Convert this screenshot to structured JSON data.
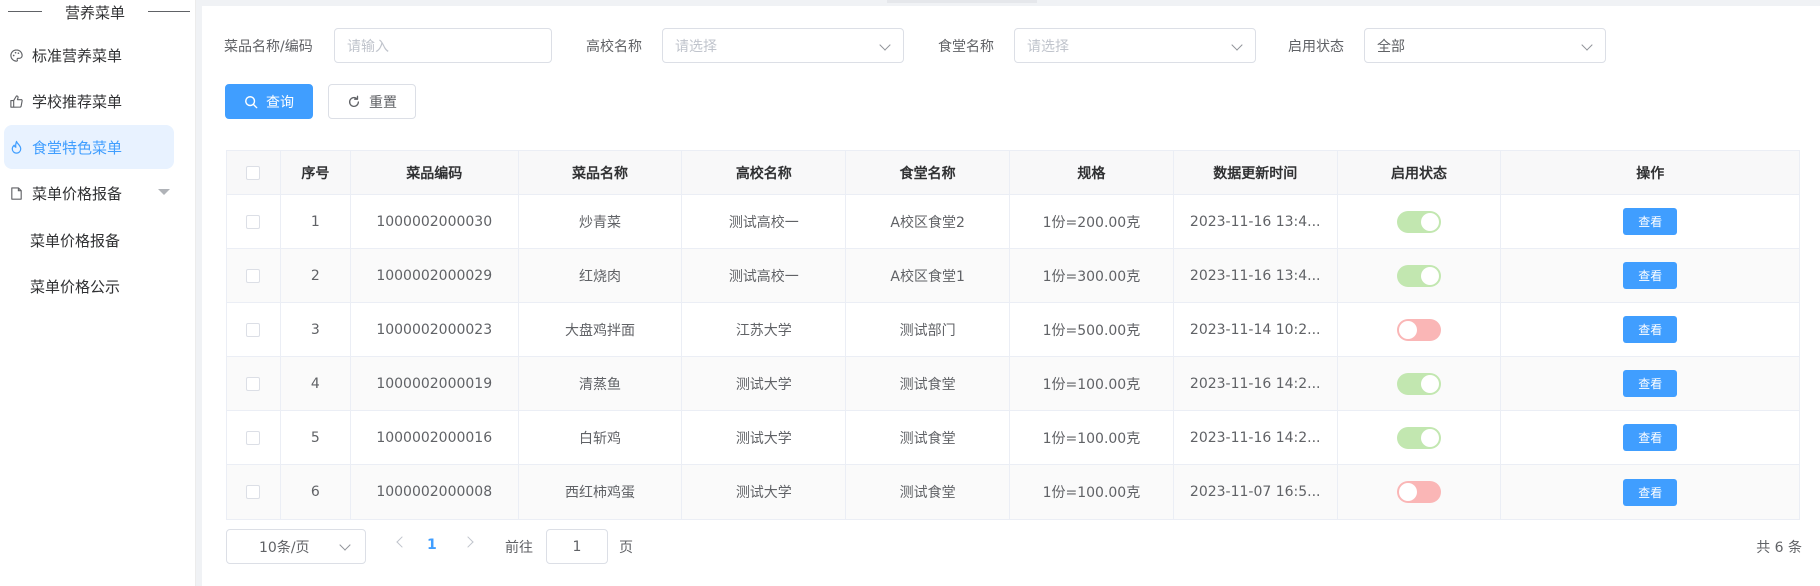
{
  "sidebar": {
    "title": "营养菜单",
    "items": [
      {
        "label": "标准营养菜单",
        "icon": "palette-icon"
      },
      {
        "label": "学校推荐菜单",
        "icon": "thumbs-up-icon"
      },
      {
        "label": "食堂特色菜单",
        "icon": "flame-icon",
        "active": true
      },
      {
        "label": "菜单价格报备",
        "icon": "document-icon",
        "expanded": true
      }
    ],
    "sub_items": [
      {
        "label": "菜单价格报备"
      },
      {
        "label": "菜单价格公示"
      }
    ]
  },
  "filters": {
    "dish_label": "菜品名称/编码",
    "dish_placeholder": "请输入",
    "school_label": "高校名称",
    "school_placeholder": "请选择",
    "canteen_label": "食堂名称",
    "canteen_placeholder": "请选择",
    "status_label": "启用状态",
    "status_value": "全部"
  },
  "actions": {
    "search_label": "查询",
    "reset_label": "重置"
  },
  "table": {
    "headers": [
      "序号",
      "菜品编码",
      "菜品名称",
      "高校名称",
      "食堂名称",
      "规格",
      "数据更新时间",
      "启用状态",
      "操作"
    ],
    "rows": [
      {
        "index": "1",
        "code": "1000002000030",
        "name": "炒青菜",
        "school": "测试高校一",
        "canteen": "A校区食堂2",
        "spec": "1份=200.00克",
        "updated": "2023-11-16 13:4...",
        "enabled": true,
        "action": "查看"
      },
      {
        "index": "2",
        "code": "1000002000029",
        "name": "红烧肉",
        "school": "测试高校一",
        "canteen": "A校区食堂1",
        "spec": "1份=300.00克",
        "updated": "2023-11-16 13:4...",
        "enabled": true,
        "action": "查看"
      },
      {
        "index": "3",
        "code": "1000002000023",
        "name": "大盘鸡拌面",
        "school": "江苏大学",
        "canteen": "测试部门",
        "spec": "1份=500.00克",
        "updated": "2023-11-14 10:2...",
        "enabled": false,
        "action": "查看"
      },
      {
        "index": "4",
        "code": "1000002000019",
        "name": "清蒸鱼",
        "school": "测试大学",
        "canteen": "测试食堂",
        "spec": "1份=100.00克",
        "updated": "2023-11-16 14:2...",
        "enabled": true,
        "action": "查看"
      },
      {
        "index": "5",
        "code": "1000002000016",
        "name": "白斩鸡",
        "school": "测试大学",
        "canteen": "测试食堂",
        "spec": "1份=100.00克",
        "updated": "2023-11-16 14:2...",
        "enabled": true,
        "action": "查看"
      },
      {
        "index": "6",
        "code": "1000002000008",
        "name": "西红柿鸡蛋",
        "school": "测试大学",
        "canteen": "测试食堂",
        "spec": "1份=100.00克",
        "updated": "2023-11-07 16:5...",
        "enabled": false,
        "action": "查看"
      }
    ]
  },
  "pagination": {
    "page_size": "10条/页",
    "current_page": "1",
    "goto_label": "前往",
    "goto_value": "1",
    "page_unit": "页",
    "total": "共 6 条"
  },
  "colors": {
    "accent": "#409eff",
    "active_bg": "#e8f2ff",
    "switch_on": "#c2e7b0",
    "switch_off": "#fab6b6"
  }
}
